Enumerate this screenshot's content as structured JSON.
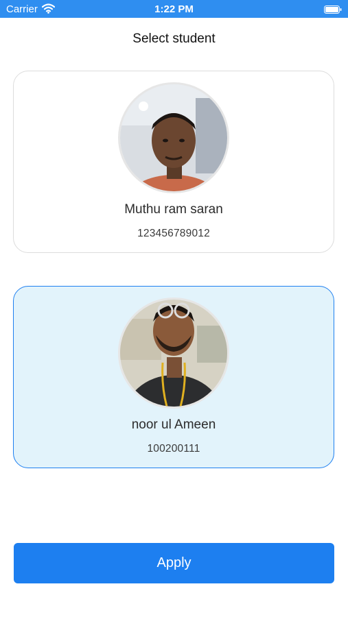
{
  "status_bar": {
    "carrier": "Carrier",
    "time": "1:22 PM",
    "wifi_icon": "wifi-icon",
    "battery_icon": "battery-icon"
  },
  "page": {
    "title": "Select student"
  },
  "students": [
    {
      "name": "Muthu ram saran",
      "id": "123456789012",
      "selected": false,
      "avatar_icon": "student-photo"
    },
    {
      "name": "noor ul Ameen",
      "id": "100200111",
      "selected": true,
      "avatar_icon": "student-photo"
    }
  ],
  "actions": {
    "apply_label": "Apply"
  },
  "colors": {
    "status_bar": "#2f8ef0",
    "accent": "#1d7ff0",
    "selected_card_bg": "#e2f3fb",
    "card_border": "#dcdcdc"
  }
}
